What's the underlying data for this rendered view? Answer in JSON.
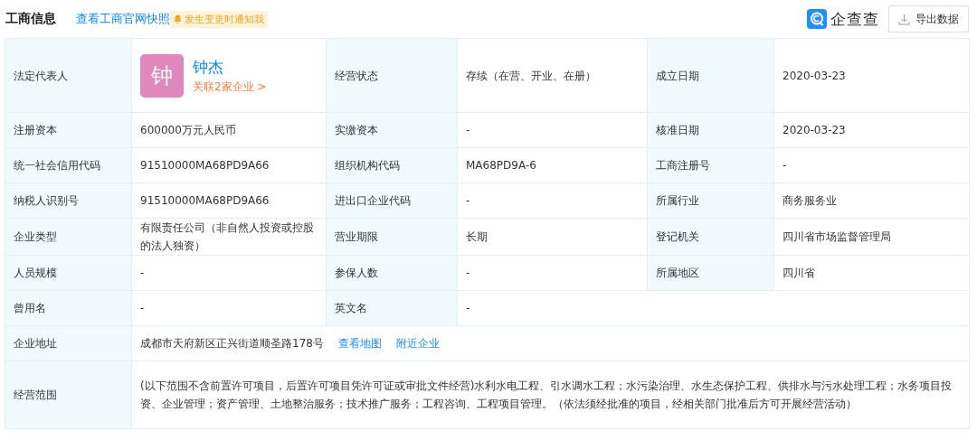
{
  "header": {
    "title": "工商信息",
    "snapshot_link": "查看工商官网快照",
    "notify_badge": "发生变更时通知我",
    "brand": "企查查",
    "export_button": "导出数据"
  },
  "rows": [
    {
      "fields": [
        {
          "kind": "person",
          "label": "法定代表人",
          "avatar": "钟",
          "name": "钟杰",
          "related": "关联2家企业 >"
        },
        {
          "kind": "text",
          "label": "经营状态",
          "value": "存续（在营、开业、在册）"
        },
        {
          "kind": "text",
          "label": "成立日期",
          "value": "2020-03-23"
        }
      ]
    },
    {
      "fields": [
        {
          "kind": "text",
          "label": "注册资本",
          "value": "600000万元人民币"
        },
        {
          "kind": "text",
          "label": "实缴资本",
          "value": "-"
        },
        {
          "kind": "text",
          "label": "核准日期",
          "value": "2020-03-23"
        }
      ]
    },
    {
      "fields": [
        {
          "kind": "text",
          "label": "统一社会信用代码",
          "value": "91510000MA68PD9A66"
        },
        {
          "kind": "text",
          "label": "组织机构代码",
          "value": "MA68PD9A-6"
        },
        {
          "kind": "text",
          "label": "工商注册号",
          "value": "-"
        }
      ]
    },
    {
      "fields": [
        {
          "kind": "text",
          "label": "纳税人识别号",
          "value": "91510000MA68PD9A66"
        },
        {
          "kind": "text",
          "label": "进出口企业代码",
          "value": "-"
        },
        {
          "kind": "text",
          "label": "所属行业",
          "value": "商务服务业"
        }
      ]
    },
    {
      "fields": [
        {
          "kind": "text",
          "label": "企业类型",
          "value": "有限责任公司（非自然人投资或控股的法人独资）"
        },
        {
          "kind": "text",
          "label": "营业期限",
          "value": "长期"
        },
        {
          "kind": "text",
          "label": "登记机关",
          "value": "四川省市场监督管理局"
        }
      ]
    },
    {
      "fields": [
        {
          "kind": "text",
          "label": "人员规模",
          "value": "-"
        },
        {
          "kind": "text",
          "label": "参保人数",
          "value": "-"
        },
        {
          "kind": "text",
          "label": "所属地区",
          "value": "四川省"
        }
      ]
    },
    {
      "fields": [
        {
          "kind": "text",
          "label": "曾用名",
          "value": "-"
        },
        {
          "kind": "text",
          "label": "英文名",
          "value": "-"
        }
      ]
    },
    {
      "fields": [
        {
          "kind": "address",
          "label": "企业地址",
          "value": "成都市天府新区正兴街道顺圣路178号",
          "links": [
            "查看地图",
            "附近企业"
          ]
        }
      ]
    },
    {
      "fields": [
        {
          "kind": "long",
          "label": "经营范围",
          "value": "(以下范围不含前置许可项目，后置许可项目凭许可证或审批文件经营)水利水电工程、引水调水工程；水污染治理、水生态保护工程、供排水与污水处理工程；水务项目投资、企业管理；资产管理、土地整治服务；技术推广服务；工程咨询、工程项目管理。（依法须经批准的项目，经相关部门批准后方可开展经营活动）"
        }
      ]
    }
  ]
}
